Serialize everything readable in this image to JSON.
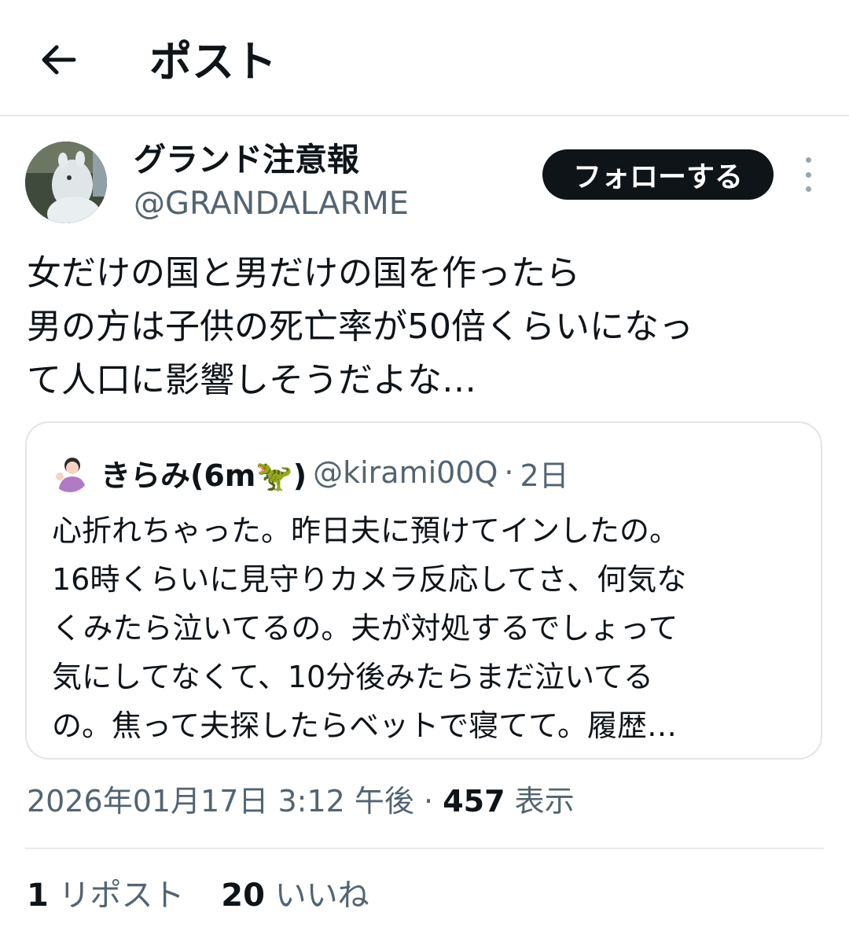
{
  "header": {
    "title": "ポスト",
    "back_icon": "arrow-left-icon"
  },
  "author": {
    "display_name": "グランド注意報",
    "handle": "@GRANDALARME",
    "follow_label": "フォローする",
    "more_icon": "more-vertical-icon"
  },
  "post": {
    "lines": [
      "女だけの国と男だけの国を作ったら",
      "男の方は子供の死亡率が50倍くらいになっ",
      "て人口に影響しそうだよな…"
    ]
  },
  "quote": {
    "name": "きらみ(6m🦖)",
    "handle": "@kirami00Q",
    "separator": "·",
    "time": "2日",
    "lines": [
      "心折れちゃった。昨日夫に預けてインしたの。",
      "16時くらいに見守りカメラ反応してさ、何気な",
      "くみたら泣いてるの。夫が対処するでしょって",
      "気にしてなくて、10分後みたらまだ泣いてる",
      "の。焦って夫探したらベットで寝てて。履歴…"
    ]
  },
  "meta": {
    "datetime": "2026年01月17日 3:12 午後",
    "separator": "·",
    "views_count": "457",
    "views_label": "表示"
  },
  "stats": {
    "reposts_count": "1",
    "reposts_label": "リポスト",
    "likes_count": "20",
    "likes_label": "いいね"
  },
  "colors": {
    "text_primary": "#0f1419",
    "text_secondary": "#536471",
    "border": "#e7e9ea",
    "follow_bg": "#0f1419"
  }
}
